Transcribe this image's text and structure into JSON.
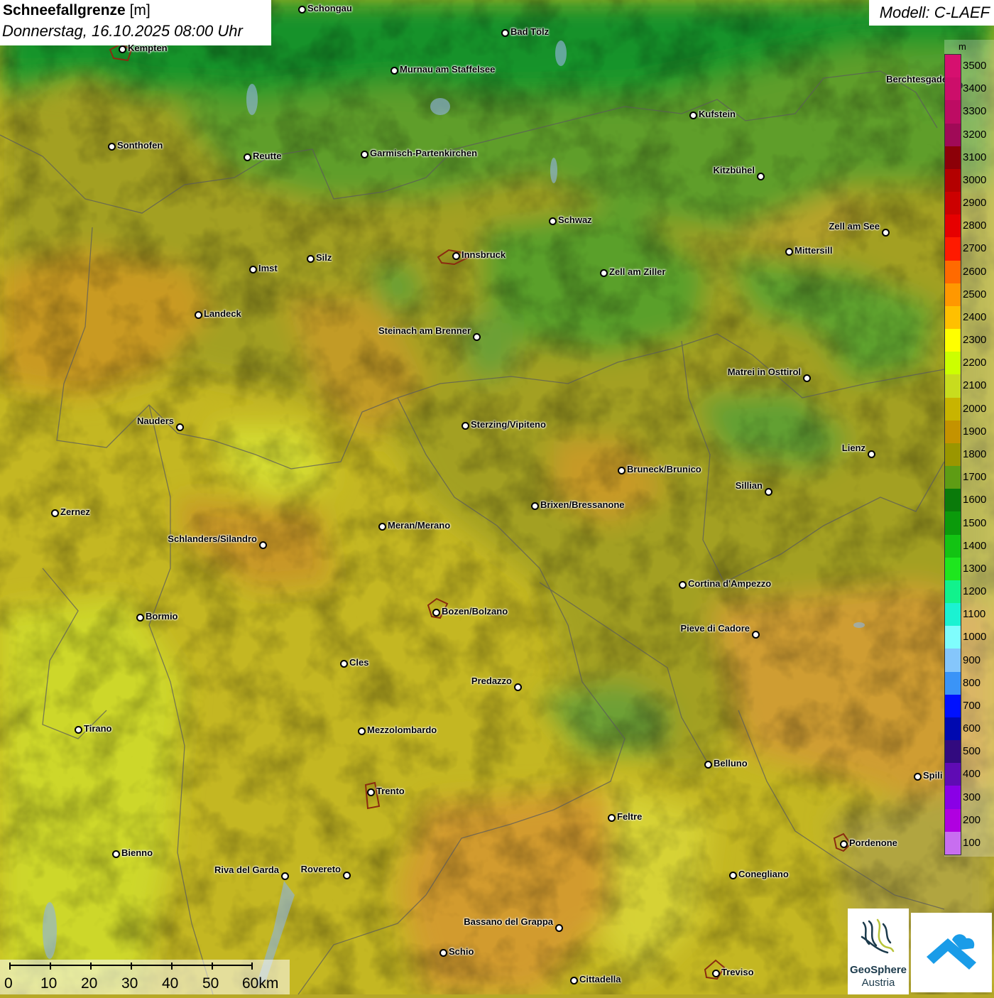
{
  "title": {
    "variable": "Schneefallgrenze",
    "unit": "[m]",
    "datetime": "Donnerstag, 16.10.2025 08:00 Uhr"
  },
  "model_label": "Modell: C-LAEF",
  "legend": {
    "unit": "m",
    "levels": [
      {
        "label": "3500",
        "color": "#d6106f"
      },
      {
        "label": "3400",
        "color": "#cc0e6a"
      },
      {
        "label": "3300",
        "color": "#bd0c63"
      },
      {
        "label": "3200",
        "color": "#a00a57"
      },
      {
        "label": "3100",
        "color": "#8c0008"
      },
      {
        "label": "3000",
        "color": "#b30000"
      },
      {
        "label": "2900",
        "color": "#cc0000"
      },
      {
        "label": "2800",
        "color": "#e60000"
      },
      {
        "label": "2700",
        "color": "#ff1a00"
      },
      {
        "label": "2600",
        "color": "#ff6a00"
      },
      {
        "label": "2500",
        "color": "#ff9800"
      },
      {
        "label": "2400",
        "color": "#ffc000"
      },
      {
        "label": "2300",
        "color": "#ffff00"
      },
      {
        "label": "2200",
        "color": "#ccff00"
      },
      {
        "label": "2100",
        "color": "#c8dc1e"
      },
      {
        "label": "2000",
        "color": "#c8b400"
      },
      {
        "label": "1900",
        "color": "#c49300"
      },
      {
        "label": "1800",
        "color": "#9a9600"
      },
      {
        "label": "1700",
        "color": "#5e9c14"
      },
      {
        "label": "1600",
        "color": "#0a7a0a"
      },
      {
        "label": "1500",
        "color": "#0b9a0b"
      },
      {
        "label": "1400",
        "color": "#13c313"
      },
      {
        "label": "1300",
        "color": "#1ee61e"
      },
      {
        "label": "1200",
        "color": "#11f28c"
      },
      {
        "label": "1100",
        "color": "#1bf2d2"
      },
      {
        "label": "1000",
        "color": "#7ffdfd"
      },
      {
        "label": "900",
        "color": "#85c6fb"
      },
      {
        "label": "800",
        "color": "#3a94f7"
      },
      {
        "label": "700",
        "color": "#0011ff"
      },
      {
        "label": "600",
        "color": "#0009b0"
      },
      {
        "label": "500",
        "color": "#320a7f"
      },
      {
        "label": "400",
        "color": "#5f0bb4"
      },
      {
        "label": "300",
        "color": "#8a00e6"
      },
      {
        "label": "200",
        "color": "#b000e0"
      },
      {
        "label": "100",
        "color": "#c86ef0"
      }
    ]
  },
  "cities": [
    {
      "name": "Schongau"
    },
    {
      "name": "Bad Tölz"
    },
    {
      "name": "Kempten"
    },
    {
      "name": "Murnau am Staffelsee"
    },
    {
      "name": "Berchtesgaden"
    },
    {
      "name": "Kufstein"
    },
    {
      "name": "Sonthofen"
    },
    {
      "name": "Reutte"
    },
    {
      "name": "Garmisch-Partenkirchen"
    },
    {
      "name": "Kitzbühel"
    },
    {
      "name": "Schwaz"
    },
    {
      "name": "Zell am See"
    },
    {
      "name": "Innsbruck"
    },
    {
      "name": "Mittersill"
    },
    {
      "name": "Imst"
    },
    {
      "name": "Silz"
    },
    {
      "name": "Zell am Ziller"
    },
    {
      "name": "Landeck"
    },
    {
      "name": "Steinach am Brenner"
    },
    {
      "name": "Matrei in Osttirol"
    },
    {
      "name": "Nauders"
    },
    {
      "name": "Sterzing/Vipiteno"
    },
    {
      "name": "Lienz"
    },
    {
      "name": "Bruneck/Brunico"
    },
    {
      "name": "Sillian"
    },
    {
      "name": "Zernez"
    },
    {
      "name": "Brixen/Bressanone"
    },
    {
      "name": "Meran/Merano"
    },
    {
      "name": "Schlanders/Silandro"
    },
    {
      "name": "Cortina d'Ampezzo"
    },
    {
      "name": "Bozen/Bolzano"
    },
    {
      "name": "Bormio"
    },
    {
      "name": "Pieve di Cadore"
    },
    {
      "name": "Cles"
    },
    {
      "name": "Predazzo"
    },
    {
      "name": "Tirano"
    },
    {
      "name": "Mezzolombardo"
    },
    {
      "name": "Belluno"
    },
    {
      "name": "Spili"
    },
    {
      "name": "Trento"
    },
    {
      "name": "Feltre"
    },
    {
      "name": "Pordenone"
    },
    {
      "name": "Bienno"
    },
    {
      "name": "Riva del Garda"
    },
    {
      "name": "Rovereto"
    },
    {
      "name": "Conegliano"
    },
    {
      "name": "Bassano del Grappa"
    },
    {
      "name": "Schio"
    },
    {
      "name": "Treviso"
    },
    {
      "name": "Cittadella"
    }
  ],
  "scale": {
    "labels": [
      "0",
      "10",
      "20",
      "30",
      "40",
      "50",
      "60km"
    ]
  },
  "logo": {
    "line1": "GeoSphere",
    "line2": "Austria"
  }
}
